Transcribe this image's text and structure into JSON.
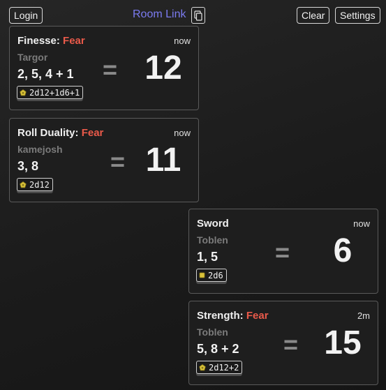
{
  "header": {
    "login_label": "Login",
    "room_link_label": "Room Link",
    "copy_icon": "copy-icon",
    "clear_label": "Clear",
    "settings_label": "Settings"
  },
  "colors": {
    "fear": "#ea5a4a",
    "room_link": "#7b7bf0",
    "die_icon": "#d9c23a"
  },
  "rolls": [
    {
      "action": "Finesse",
      "separator": ": ",
      "tag": "Fear",
      "time": "now",
      "player": "Targor",
      "rolls": "2, 5, 4 + 1",
      "equals": "=",
      "total": "12",
      "formula": "2d12+1d6+1",
      "die_icon": "d12-die-icon"
    },
    {
      "action": "Roll Duality",
      "separator": ": ",
      "tag": "Fear",
      "time": "now",
      "player": "kamejosh",
      "rolls": "3, 8",
      "equals": "=",
      "total": "11",
      "formula": "2d12",
      "die_icon": "d12-die-icon"
    },
    {
      "action": "Sword",
      "time": "now",
      "player": "Toblen",
      "rolls": "1, 5",
      "equals": "=",
      "total": "6",
      "formula": "2d6",
      "die_icon": "d6-die-icon"
    },
    {
      "action": "Strength",
      "separator": ": ",
      "tag": "Fear",
      "time": "2m",
      "player": "Toblen",
      "rolls": "5, 8 + 2",
      "equals": "=",
      "total": "15",
      "formula": "2d12+2",
      "die_icon": "d12-die-icon"
    }
  ]
}
